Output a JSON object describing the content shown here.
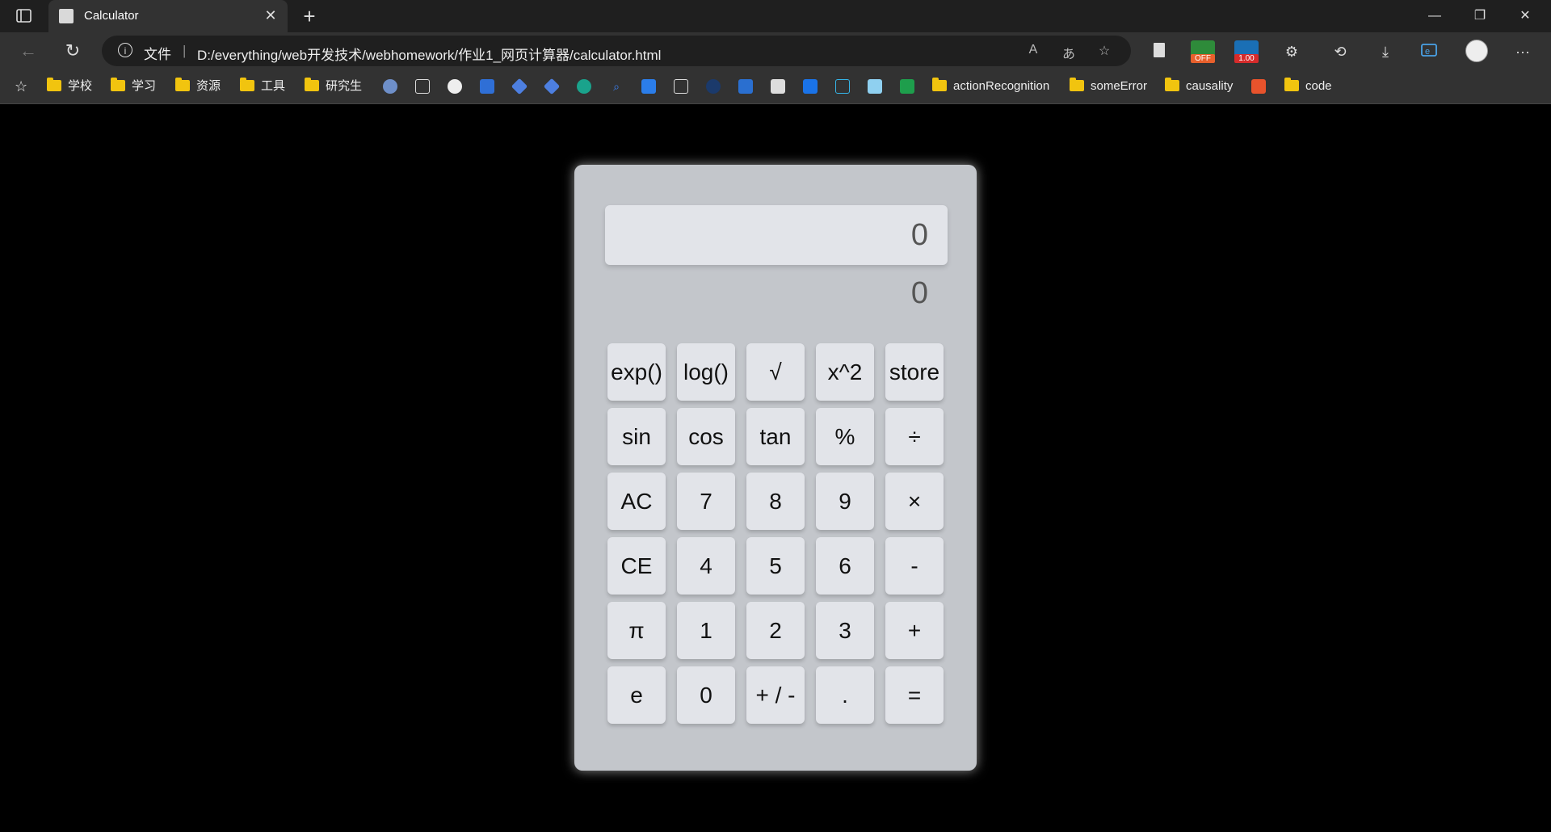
{
  "tab": {
    "title": "Calculator"
  },
  "address": {
    "scheme": "文件",
    "url": "D:/everything/web开发技术/webhomework/作业1_网页计算器/calculator.html"
  },
  "extensions": {
    "off_badge": "OFF",
    "speed_badge": "1.00"
  },
  "bookmarks": {
    "folders_left": [
      "学校",
      "学习",
      "资源",
      "工具",
      "研究生"
    ],
    "folders_right": [
      "actionRecognition",
      "someError",
      "causality",
      "code"
    ]
  },
  "calculator": {
    "display": "0",
    "result": "0",
    "keys": [
      "exp()",
      "log()",
      "√",
      "x^2",
      "store",
      "sin",
      "cos",
      "tan",
      "%",
      "÷",
      "AC",
      "7",
      "8",
      "9",
      "×",
      "CE",
      "4",
      "5",
      "6",
      "-",
      "π",
      "1",
      "2",
      "3",
      "+",
      "e",
      "0",
      "+ / -",
      ".",
      "="
    ]
  },
  "icons": [
    "tab-actions-icon",
    "close-icon",
    "new-tab-icon",
    "minimize-icon",
    "maximize-icon",
    "window-close-icon",
    "back-icon",
    "refresh-icon",
    "info-icon",
    "read-aloud-icon",
    "translate-icon",
    "add-favorite-icon",
    "favorites-star-icon",
    "history-icon",
    "download-icon",
    "extensions-icon",
    "more-icon"
  ]
}
